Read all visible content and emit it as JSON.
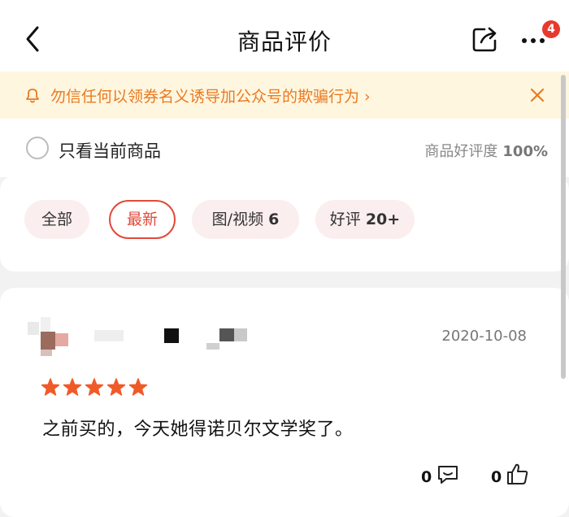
{
  "header": {
    "title": "商品评价",
    "badge_count": "4",
    "icons": {
      "back": "back-arrow-icon",
      "share": "share-icon",
      "more": "more-icon"
    }
  },
  "notice": {
    "text": "勿信任何以领券名义诱导加公众号的欺骗行为 ›",
    "icons": {
      "left": "bell-icon",
      "close": "close-icon"
    },
    "color": "#e97a22"
  },
  "filter": {
    "only_current_label": "只看当前商品",
    "rating_label": "商品好评度",
    "rating_value": "100%"
  },
  "tags": [
    {
      "label": "全部",
      "count": ""
    },
    {
      "label": "最新",
      "count": ""
    },
    {
      "label": "图/视频",
      "count": "6"
    },
    {
      "label": "好评",
      "count": "20+"
    }
  ],
  "review": {
    "date": "2020-10-08",
    "rating": 5,
    "text": "之前买的，今天她得诺贝尔文学奖了。",
    "comment_count": "0",
    "like_count": "0"
  },
  "colors": {
    "accent": "#e24a3a",
    "star": "#f05a28",
    "notice_bg": "#fff6df"
  }
}
